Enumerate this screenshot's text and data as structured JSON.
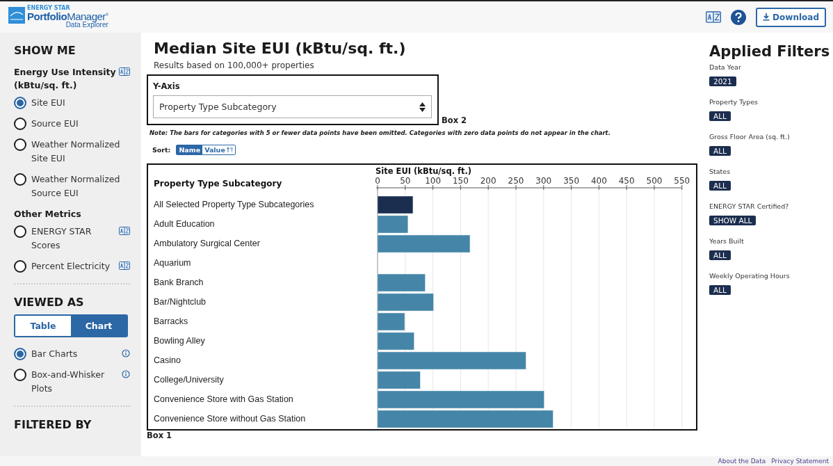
{
  "header": {
    "logo": {
      "brand": "ENERGY STAR",
      "product_bold": "Portfolio",
      "product_light": "Manager",
      "mark": "®",
      "subtitle": "Data Explorer"
    },
    "download_button": "Download"
  },
  "sidebar": {
    "title": "SHOW ME",
    "sections": [
      {
        "heading": "Energy Use Intensity (kBtu/sq. ft.)",
        "glossary": true,
        "options": [
          {
            "label": "Site EUI",
            "selected": true,
            "glossary": false
          },
          {
            "label": "Source EUI",
            "selected": false,
            "glossary": false
          },
          {
            "label": "Weather Normalized Site EUI",
            "selected": false,
            "glossary": false
          },
          {
            "label": "Weather Normalized Source EUI",
            "selected": false,
            "glossary": false
          }
        ]
      },
      {
        "heading": "Other Metrics",
        "glossary": false,
        "options": [
          {
            "label": "ENERGY STAR Scores",
            "selected": false,
            "glossary": true
          },
          {
            "label": "Percent Electricity",
            "selected": false,
            "glossary": true
          }
        ]
      }
    ],
    "viewed_as": {
      "title": "VIEWED AS",
      "toggle": [
        {
          "label": "Table",
          "selected": false
        },
        {
          "label": "Chart",
          "selected": true
        }
      ],
      "options": [
        {
          "label": "Bar Charts",
          "selected": true
        },
        {
          "label": "Box-and-Whisker Plots",
          "selected": false
        }
      ]
    },
    "filtered_by": "FILTERED BY"
  },
  "main": {
    "title": "Median Site EUI (kBtu/sq. ft.)",
    "subtitle": "Results based on 100,000+ properties",
    "y_axis": {
      "label": "Y-Axis",
      "value": "Property Type Subcategory",
      "annotation": "Box 2"
    },
    "note": "Note: The bars for categories with 5 or fewer data points have been omitted. Categories with zero data points do not appear in the chart.",
    "sort": {
      "label": "Sort:",
      "options": [
        {
          "label": "Name",
          "selected": true
        },
        {
          "label": "Value",
          "selected": false
        }
      ]
    },
    "chart_annotation": "Box 1",
    "chart_data": {
      "type": "bar",
      "orientation": "horizontal",
      "title": "Property Type Subcategory",
      "xlabel": "Site EUI (kBtu/sq. ft.)",
      "xlim": [
        0,
        550
      ],
      "xticks": [
        0,
        50,
        100,
        150,
        200,
        250,
        300,
        350,
        400,
        450,
        500,
        550
      ],
      "categories": [
        "All Selected Property Type Subcategories",
        "Adult Education",
        "Ambulatory Surgical Center",
        "Aquarium",
        "Bank Branch",
        "Bar/Nightclub",
        "Barracks",
        "Bowling Alley",
        "Casino",
        "College/University",
        "Convenience Store with Gas Station",
        "Convenience Store without Gas Station"
      ],
      "grid": true,
      "series": [
        {
          "color": "#1c2e4f",
          "values": [
            64,
            null,
            null,
            null,
            null,
            null,
            null,
            null,
            null,
            null,
            null,
            null
          ]
        },
        {
          "color": "#4585a8",
          "values": [
            null,
            55,
            167,
            null,
            86,
            101,
            49,
            66,
            268,
            77,
            301,
            317
          ]
        }
      ]
    }
  },
  "applied_filters": {
    "title": "Applied Filters",
    "filters": [
      {
        "label": "Data Year",
        "value": "2021"
      },
      {
        "label": "Property Types",
        "value": "ALL"
      },
      {
        "label": "Gross Floor Area (sq. ft.)",
        "value": "ALL"
      },
      {
        "label": "States",
        "value": "ALL"
      },
      {
        "label": "ENERGY STAR Certified?",
        "value": "SHOW ALL"
      },
      {
        "label": "Years Built",
        "value": "ALL"
      },
      {
        "label": "Weekly Operating Hours",
        "value": "ALL"
      }
    ]
  },
  "footer": {
    "links": [
      "About the Data",
      "Privacy Statement"
    ]
  }
}
